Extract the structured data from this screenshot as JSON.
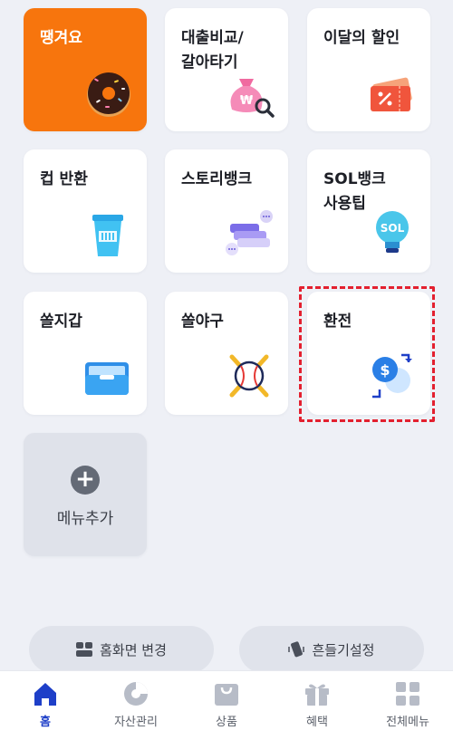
{
  "tiles": [
    {
      "label": "땡겨요",
      "icon": "donut-icon"
    },
    {
      "label": "대출비교/\n갈아타기",
      "icon": "money-bag-search-icon"
    },
    {
      "label": "이달의 할인",
      "icon": "discount-coupon-icon"
    },
    {
      "label": "컵 반환",
      "icon": "cup-icon"
    },
    {
      "label": "스토리뱅크",
      "icon": "chat-bubbles-icon"
    },
    {
      "label": "SOL뱅크\n사용팁",
      "icon": "lightbulb-icon"
    },
    {
      "label": "쏠지갑",
      "icon": "wallet-icon"
    },
    {
      "label": "쏠야구",
      "icon": "baseball-icon"
    },
    {
      "label": "환전",
      "icon": "currency-exchange-icon"
    }
  ],
  "add_menu": {
    "label": "메뉴추가",
    "icon": "plus-icon"
  },
  "bottom_buttons": {
    "change_home": "홈화면 변경",
    "shake_settings": "흔들기설정"
  },
  "nav": [
    {
      "label": "홈",
      "icon": "home-icon",
      "active": true
    },
    {
      "label": "자산관리",
      "icon": "pie-chart-icon",
      "active": false
    },
    {
      "label": "상품",
      "icon": "shopping-bag-icon",
      "active": false
    },
    {
      "label": "혜택",
      "icon": "gift-icon",
      "active": false
    },
    {
      "label": "전체메뉴",
      "icon": "grid-menu-icon",
      "active": false
    }
  ],
  "colors": {
    "accent_orange": "#f7750d",
    "nav_active": "#1e3fc8",
    "highlight_red": "#e3202f",
    "background": "#eef0f6"
  }
}
